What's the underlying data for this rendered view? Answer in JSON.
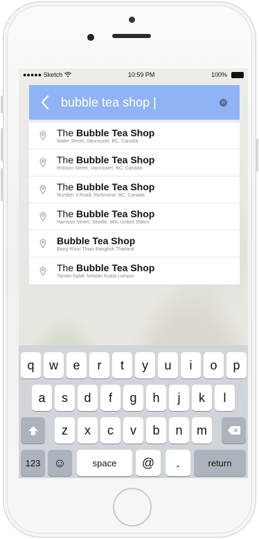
{
  "status_bar": {
    "carrier": "●●●●● Sketch",
    "wifi_icon": "wifi-icon",
    "time": "10:59 PM",
    "battery": "100%"
  },
  "search": {
    "value": "bubble tea shop |"
  },
  "results": [
    {
      "prefix": "The ",
      "bold": "Bubble Tea Shop",
      "address": "Water Street, Vancouver, BC, Canada"
    },
    {
      "prefix": "The ",
      "bold": "Bubble Tea Shop",
      "address": "Robson Street, Vancouver, BC, Canada"
    },
    {
      "prefix": "The ",
      "bold": "Bubble Tea Shop",
      "address": "Number 3 Road, Richmond, BC, Canada"
    },
    {
      "prefix": "The ",
      "bold": "Bubble Tea Shop",
      "address": "Harrison Street, Seattle, WA, United States"
    },
    {
      "prefix": "",
      "bold": "Bubble Tea Shop",
      "address": "Bang Khun Thian Bangkok Thailand"
    },
    {
      "prefix": "The ",
      "bold": "Bubble Tea Shop",
      "address": "Taman Salak Selatan Kuala Lumpur"
    }
  ],
  "keyboard": {
    "row1": [
      "q",
      "w",
      "e",
      "r",
      "t",
      "y",
      "u",
      "i",
      "o",
      "p"
    ],
    "row2": [
      "a",
      "s",
      "d",
      "f",
      "g",
      "h",
      "j",
      "k",
      "l"
    ],
    "row3": [
      "z",
      "x",
      "c",
      "v",
      "b",
      "n",
      "m"
    ],
    "numbers": "123",
    "emoji": "☺",
    "space": "space",
    "at": "@",
    "period": ".",
    "return": "return",
    "shift": "⇧",
    "delete": "⌫"
  },
  "colors": {
    "search_bar": "#8fb3f5",
    "keyboard_bg": "#d1d4d9"
  }
}
